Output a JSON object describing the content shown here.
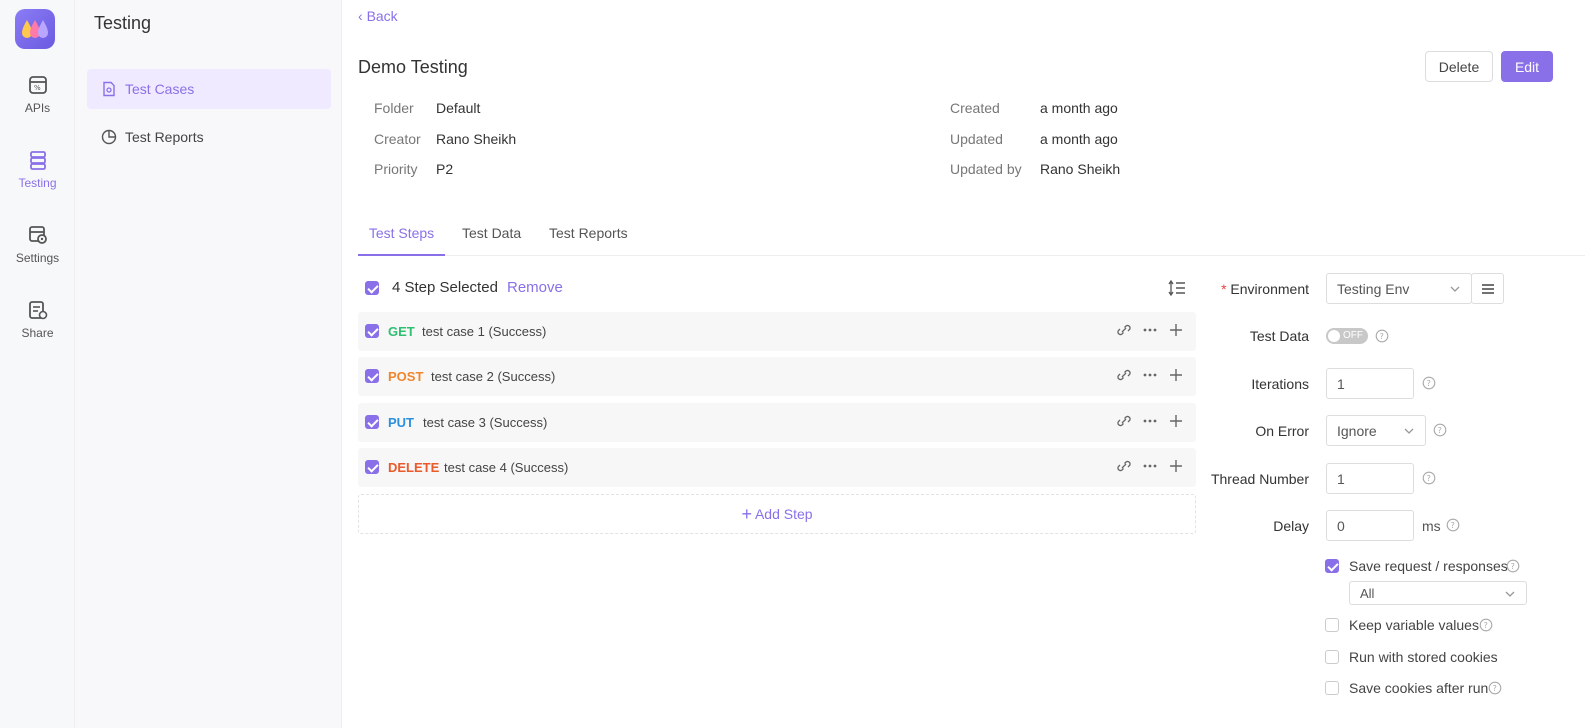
{
  "rail": {
    "items": [
      {
        "label": "APIs",
        "icon": "api-icon"
      },
      {
        "label": "Testing",
        "icon": "testing-icon"
      },
      {
        "label": "Settings",
        "icon": "settings-icon"
      },
      {
        "label": "Share",
        "icon": "share-icon"
      }
    ],
    "active": "Testing"
  },
  "sidebar": {
    "title": "Testing",
    "items": [
      {
        "label": "Test Cases",
        "icon": "file-icon"
      },
      {
        "label": "Test Reports",
        "icon": "pie-chart-icon"
      }
    ]
  },
  "header": {
    "back": "Back",
    "title": "Demo Testing",
    "delete_label": "Delete",
    "edit_label": "Edit"
  },
  "meta": {
    "folder_label": "Folder",
    "folder": "Default",
    "creator_label": "Creator",
    "creator": "Rano Sheikh",
    "priority_label": "Priority",
    "priority": "P2",
    "created_label": "Created",
    "created": "a month ago",
    "updated_label": "Updated",
    "updated": "a month ago",
    "updated_by_label": "Updated by",
    "updated_by": "Rano Sheikh"
  },
  "tabs": [
    "Test Steps",
    "Test Data",
    "Test Reports"
  ],
  "steps_header": {
    "selected_text": "4 Step Selected",
    "remove": "Remove"
  },
  "steps": [
    {
      "method": "GET",
      "color": "#2fbf71",
      "name": "test case 1 (Success)"
    },
    {
      "method": "POST",
      "color": "#f0862c",
      "name": "test case 2 (Success)"
    },
    {
      "method": "PUT",
      "color": "#2b8fe0",
      "name": "test case 3 (Success)"
    },
    {
      "method": "DELETE",
      "color": "#eb5a2a",
      "name": "test case 4 (Success)"
    }
  ],
  "add_step": "Add Step",
  "form": {
    "environment_label": "Environment",
    "environment_value": "Testing Env",
    "test_data_label": "Test Data",
    "test_data_toggle": "OFF",
    "iterations_label": "Iterations",
    "iterations_value": "1",
    "on_error_label": "On Error",
    "on_error_value": "Ignore",
    "thread_label": "Thread Number",
    "thread_value": "1",
    "delay_label": "Delay",
    "delay_value": "0",
    "delay_unit": "ms",
    "save_req_label": "Save request / responses",
    "save_req_scope": "All",
    "keep_var_label": "Keep variable values",
    "run_cookies_label": "Run with stored cookies",
    "save_cookies_label": "Save cookies after run"
  },
  "colors": {
    "accent": "#8a70e8"
  }
}
